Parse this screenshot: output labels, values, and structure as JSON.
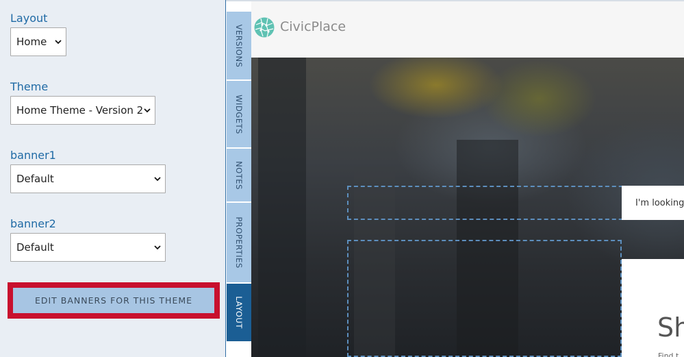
{
  "sidebar": {
    "layout": {
      "label": "Layout",
      "value": "Home"
    },
    "theme": {
      "label": "Theme",
      "value": "Home Theme - Version 2"
    },
    "banner1": {
      "label": "banner1",
      "value": "Default"
    },
    "banner2": {
      "label": "banner2",
      "value": "Default"
    },
    "edit_button_label": "EDIT BANNERS FOR THIS THEME"
  },
  "tabs": [
    {
      "label": "VERSIONS",
      "active": false
    },
    {
      "label": "WIDGETS",
      "active": false
    },
    {
      "label": "NOTES",
      "active": false
    },
    {
      "label": "PROPERTIES",
      "active": false
    },
    {
      "label": "LAYOUT",
      "active": true
    }
  ],
  "preview": {
    "logo_text": "CivicPlace",
    "search_placeholder": "I'm looking",
    "heading_partial": "Sh",
    "sub_partial": "Find t"
  },
  "colors": {
    "accent": "#1f6aa5",
    "active_tab": "#1b5e94",
    "tab": "#a8c8e6",
    "highlight": "#c8102e",
    "button": "#a7c5e3"
  }
}
